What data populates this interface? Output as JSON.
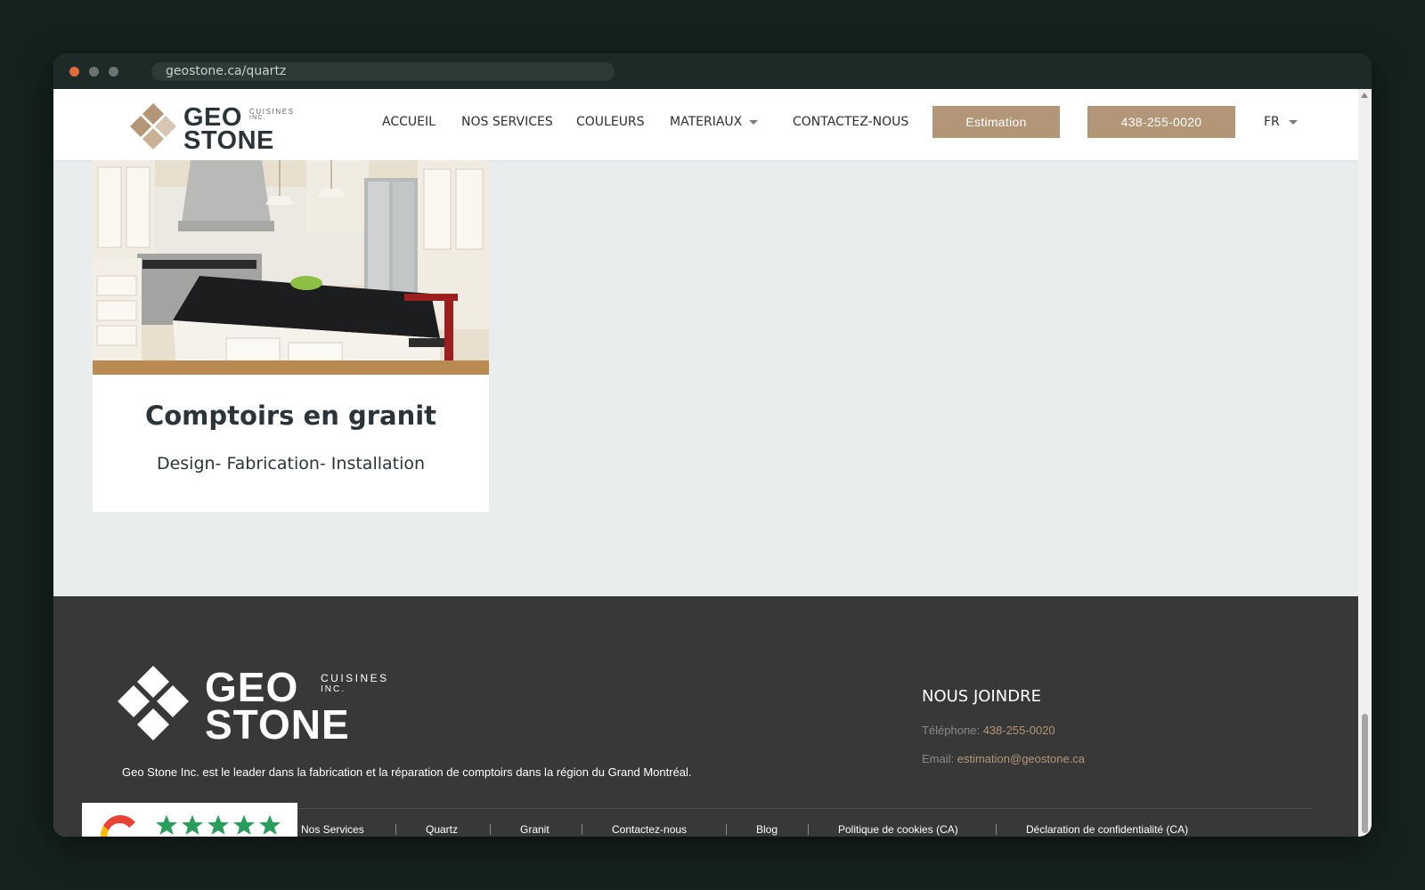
{
  "browser": {
    "url": "geostone.ca/quartz"
  },
  "header": {
    "logo": {
      "geo": "GEO",
      "stone": "STONE",
      "cuisines": "CUISINES",
      "inc": "INC."
    },
    "nav": [
      {
        "label": "ACCUEIL"
      },
      {
        "label": "NOS SERVICES"
      },
      {
        "label": "COULEURS"
      },
      {
        "label": "MATERIAUX"
      },
      {
        "label": "CONTACTEZ-NOUS"
      }
    ],
    "estimate_button": "Estimation",
    "phone_button": "438-255-0020",
    "language": "FR"
  },
  "card": {
    "title": "Comptoirs en granit",
    "subtitle": "Design- Fabrication- Installation"
  },
  "footer": {
    "logo": {
      "geo": "GEO",
      "stone": "STONE",
      "cuisines": "CUISINES",
      "inc": "INC."
    },
    "description": "Geo Stone Inc. est le leader dans la fabrication et la réparation de comptoirs dans la région du Grand Montréal.",
    "contact_title": "NOUS JOINDRE",
    "phone_label": "Téléphone:",
    "phone_value": "438-255-0020",
    "email_label": "Email:",
    "email_value": "estimation@geostone.ca",
    "links": [
      {
        "label": "Nos Services"
      },
      {
        "label": "Quartz"
      },
      {
        "label": "Granit"
      },
      {
        "label": "Contactez-nous"
      },
      {
        "label": "Blog"
      },
      {
        "label": "Politique de cookies (CA)"
      },
      {
        "label": "Déclaration de confidentialité (CA)"
      }
    ]
  },
  "colors": {
    "accent": "#b39677",
    "footer_bg": "#383838",
    "page_bg": "#eaedee",
    "text_dark": "#2b3438",
    "review_star": "#2a9d5c"
  }
}
